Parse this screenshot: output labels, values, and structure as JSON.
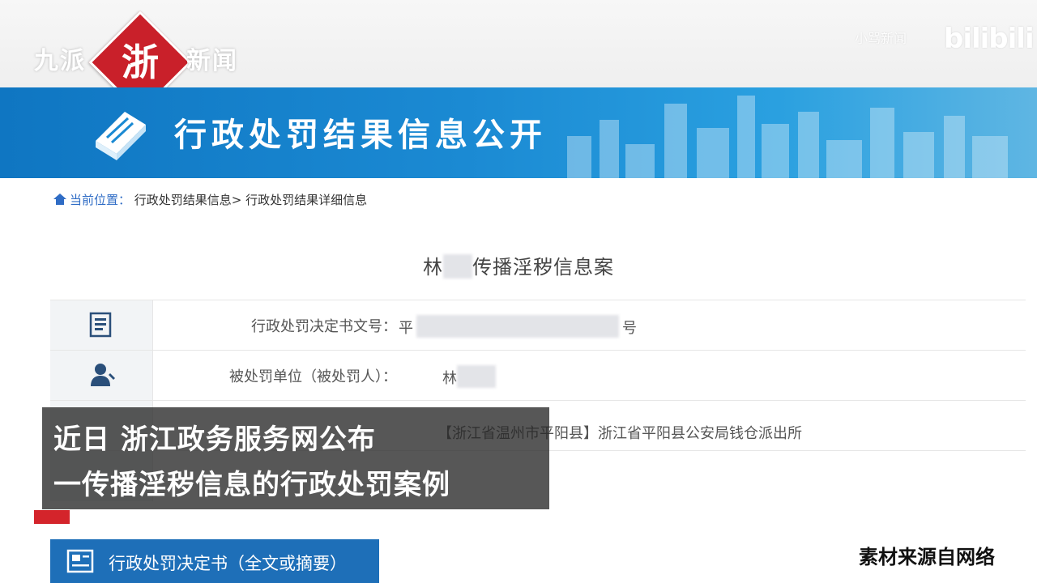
{
  "watermark": {
    "left": "九派",
    "right": "新闻",
    "seal": "浙",
    "text": "小骂新闻",
    "logo": "bilibili"
  },
  "banner": {
    "title": "行政处罚结果信息公开"
  },
  "breadcrumb": {
    "home": "当前位置：",
    "item1": "行政处罚结果信息>",
    "item2": "行政处罚结果详细信息"
  },
  "case": {
    "prefix": "林",
    "suffix": "传播淫秽信息案"
  },
  "rows": [
    {
      "label": "行政处罚决定书文号：",
      "value_prefix": "平",
      "value_suffix": "号"
    },
    {
      "label": "被处罚单位（被处罚人）：",
      "value_prefix": "林"
    },
    {
      "label": "",
      "value_prefix": "【浙江省温州市平阳县】",
      "value_suffix": "浙江省平阳县公安局钱仓派出所"
    }
  ],
  "decision_button": {
    "label": "行政处罚决定书（全文或摘要）"
  },
  "subtitle": {
    "line1": "近日 浙江政务服务网公布",
    "line2": "一传播淫秽信息的行政处罚案例"
  },
  "source_note": "素材来源自网络"
}
